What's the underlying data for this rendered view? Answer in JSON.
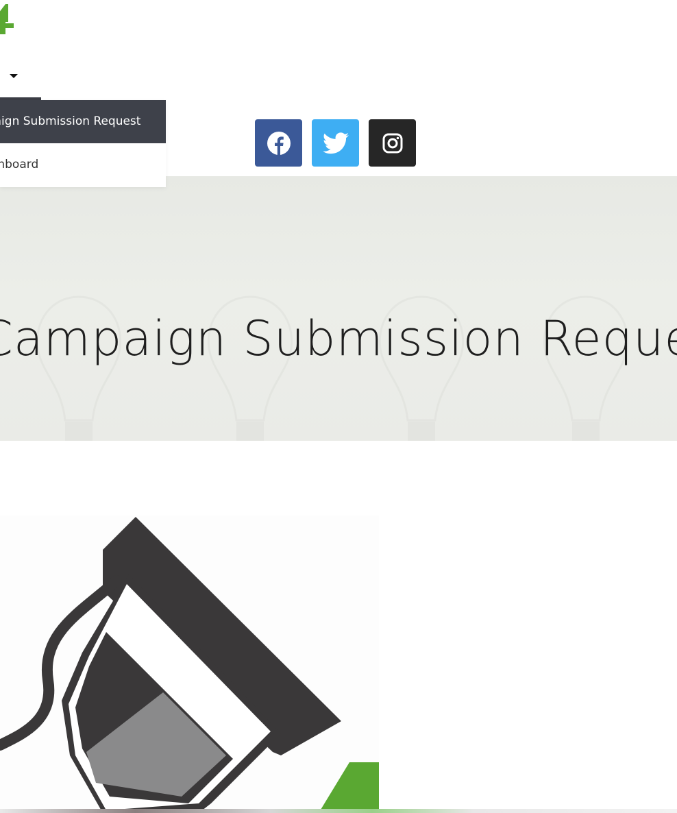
{
  "header": {
    "logo_icon": "plus-logo-icon",
    "nav_caret_icon": "caret-down-icon"
  },
  "dropdown": {
    "items": [
      {
        "label": "Campaign Submission Request",
        "active": true
      },
      {
        "label": "Dashboard",
        "active": false
      }
    ]
  },
  "social": {
    "facebook_icon": "facebook-icon",
    "twitter_icon": "twitter-icon",
    "instagram_icon": "instagram-icon"
  },
  "hero": {
    "title": "Campaign Submission Request"
  },
  "colors": {
    "brand_green": "#5aa832",
    "dropdown_active_bg": "#3e414a",
    "facebook": "#3b5998",
    "twitter": "#1da1f2",
    "instagram": "#262626"
  }
}
